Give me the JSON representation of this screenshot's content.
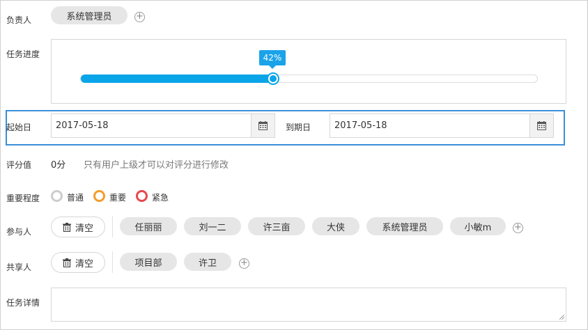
{
  "owner": {
    "label": "负责人",
    "value": "系统管理员"
  },
  "progress": {
    "label": "任务进度",
    "value": 0.42,
    "tooltip": "42%"
  },
  "dates": {
    "start_label": "起始日",
    "start_value": "2017-05-18",
    "due_label": "到期日",
    "due_value": "2017-05-18"
  },
  "score": {
    "label": "评分值",
    "value": "0分",
    "note": "只有用户上级才可以对评分进行修改"
  },
  "priority": {
    "label": "重要程度",
    "options": [
      {
        "label": "普通",
        "color": "#cccccc"
      },
      {
        "label": "重要",
        "color": "#f39c2c"
      },
      {
        "label": "紧急",
        "color": "#e8474a"
      }
    ]
  },
  "participants": {
    "label": "参与人",
    "clear_label": "清空",
    "items": [
      "任丽丽",
      "刘一二",
      "许三亩",
      "大侠",
      "系统管理员",
      "小敏m"
    ]
  },
  "sharers": {
    "label": "共享人",
    "clear_label": "清空",
    "items": [
      "项目部",
      "许卫"
    ]
  },
  "details": {
    "label": "任务详情",
    "value": ""
  },
  "colors": {
    "accent": "#0aa5e8",
    "highlight_border": "#3a8fd8"
  }
}
